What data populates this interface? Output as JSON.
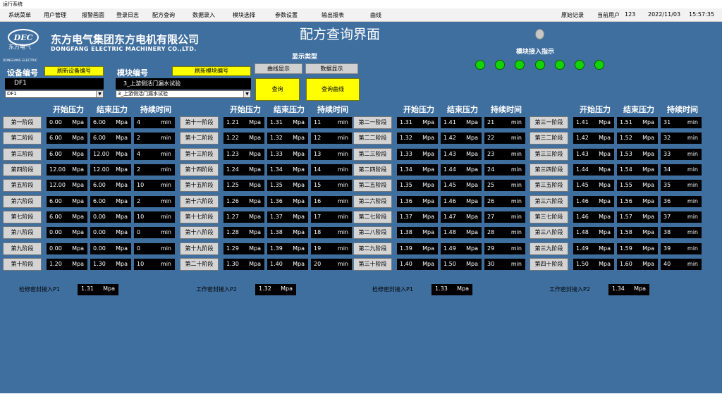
{
  "window_title": "运行系统",
  "menu": [
    "系统菜单",
    "用户管理",
    "报警画面",
    "登录日志",
    "配方查询",
    "数据录入",
    "模块选择",
    "参数设置",
    "输出报表",
    "曲线"
  ],
  "menu_right": {
    "raw_record": "原始记录",
    "current_user_label": "当前用户",
    "user_id": "123",
    "date": "2022/11/03",
    "time": "15:57:35"
  },
  "company": {
    "cn": "东方电气集团东方电机有限公司",
    "en": "DONGFANG ELECTRIC MACHINERY CO.,LTD.",
    "logo_text": "DEC",
    "logo_cn": "东方电气",
    "logo_en": "DONGFANG ELECTRIC"
  },
  "page_title": "配方查询界面",
  "device": {
    "label": "设备编号",
    "refresh_label": "刷新设备编号",
    "value": "DF1",
    "combo": "DF1"
  },
  "module": {
    "label": "模块编号",
    "refresh_label": "刷新模块编号",
    "value": "3_上游侧活门漏水试验",
    "combo": "3_上游侧活门漏水试验"
  },
  "display_type": {
    "label": "显示类型",
    "curve": "曲线显示",
    "data": "数据显示"
  },
  "buttons": {
    "query": "查询",
    "query_curve": "查询曲线"
  },
  "module_indicator_label": "模块接入指示",
  "indicator_colors": {
    "on": "#13d400"
  },
  "headers": {
    "start": "开始压力",
    "end": "结束压力",
    "duration": "持续时间"
  },
  "units": {
    "pressure": "Mpa",
    "time": "min"
  },
  "groups": [
    {
      "stages": [
        {
          "name": "第一阶段",
          "start": "0.00",
          "end": "6.00",
          "dur": "4"
        },
        {
          "name": "第二阶段",
          "start": "6.00",
          "end": "6.00",
          "dur": "2"
        },
        {
          "name": "第三阶段",
          "start": "6.00",
          "end": "12.00",
          "dur": "4"
        },
        {
          "name": "第四阶段",
          "start": "12.00",
          "end": "12.00",
          "dur": "2"
        },
        {
          "name": "第五阶段",
          "start": "12.00",
          "end": "6.00",
          "dur": "10"
        },
        {
          "name": "第六阶段",
          "start": "6.00",
          "end": "6.00",
          "dur": "2"
        },
        {
          "name": "第七阶段",
          "start": "6.00",
          "end": "0.00",
          "dur": "10"
        },
        {
          "name": "第八阶段",
          "start": "0.00",
          "end": "0.00",
          "dur": "0"
        },
        {
          "name": "第九阶段",
          "start": "0.00",
          "end": "0.00",
          "dur": "0"
        },
        {
          "name": "第十阶段",
          "start": "1.20",
          "end": "1.30",
          "dur": "10"
        }
      ]
    },
    {
      "stages": [
        {
          "name": "第十一阶段",
          "start": "1.21",
          "end": "1.31",
          "dur": "11"
        },
        {
          "name": "第十二阶段",
          "start": "1.22",
          "end": "1.32",
          "dur": "12"
        },
        {
          "name": "第十三阶段",
          "start": "1.23",
          "end": "1.33",
          "dur": "13"
        },
        {
          "name": "第十四阶段",
          "start": "1.24",
          "end": "1.34",
          "dur": "14"
        },
        {
          "name": "第十五阶段",
          "start": "1.25",
          "end": "1.35",
          "dur": "15"
        },
        {
          "name": "第十六阶段",
          "start": "1.26",
          "end": "1.36",
          "dur": "16"
        },
        {
          "name": "第十七阶段",
          "start": "1.27",
          "end": "1.37",
          "dur": "17"
        },
        {
          "name": "第十八阶段",
          "start": "1.28",
          "end": "1.38",
          "dur": "18"
        },
        {
          "name": "第十九阶段",
          "start": "1.29",
          "end": "1.39",
          "dur": "19"
        },
        {
          "name": "第二十阶段",
          "start": "1.30",
          "end": "1.40",
          "dur": "20"
        }
      ]
    },
    {
      "stages": [
        {
          "name": "第二一阶段",
          "start": "1.31",
          "end": "1.41",
          "dur": "21"
        },
        {
          "name": "第二二阶段",
          "start": "1.32",
          "end": "1.42",
          "dur": "22"
        },
        {
          "name": "第二三阶段",
          "start": "1.33",
          "end": "1.43",
          "dur": "23"
        },
        {
          "name": "第二四阶段",
          "start": "1.34",
          "end": "1.44",
          "dur": "24"
        },
        {
          "name": "第二五阶段",
          "start": "1.35",
          "end": "1.45",
          "dur": "25"
        },
        {
          "name": "第二六阶段",
          "start": "1.36",
          "end": "1.46",
          "dur": "26"
        },
        {
          "name": "第二七阶段",
          "start": "1.37",
          "end": "1.47",
          "dur": "27"
        },
        {
          "name": "第二八阶段",
          "start": "1.38",
          "end": "1.48",
          "dur": "28"
        },
        {
          "name": "第二九阶段",
          "start": "1.39",
          "end": "1.49",
          "dur": "29"
        },
        {
          "name": "第三十阶段",
          "start": "1.40",
          "end": "1.50",
          "dur": "30"
        }
      ]
    },
    {
      "stages": [
        {
          "name": "第三一阶段",
          "start": "1.41",
          "end": "1.51",
          "dur": "31"
        },
        {
          "name": "第三二阶段",
          "start": "1.42",
          "end": "1.52",
          "dur": "32"
        },
        {
          "name": "第三三阶段",
          "start": "1.43",
          "end": "1.53",
          "dur": "33"
        },
        {
          "name": "第三四阶段",
          "start": "1.44",
          "end": "1.54",
          "dur": "34"
        },
        {
          "name": "第三五阶段",
          "start": "1.45",
          "end": "1.55",
          "dur": "35"
        },
        {
          "name": "第三六阶段",
          "start": "1.46",
          "end": "1.56",
          "dur": "36"
        },
        {
          "name": "第三七阶段",
          "start": "1.46",
          "end": "1.57",
          "dur": "37"
        },
        {
          "name": "第三八阶段",
          "start": "1.48",
          "end": "1.58",
          "dur": "38"
        },
        {
          "name": "第三九阶段",
          "start": "1.49",
          "end": "1.59",
          "dur": "39"
        },
        {
          "name": "第四十阶段",
          "start": "1.50",
          "end": "1.60",
          "dur": "40"
        }
      ]
    }
  ],
  "seals": [
    {
      "label": "检修密封接入P1",
      "value": "1.31"
    },
    {
      "label": "工作密封接入P2",
      "value": "1.32"
    },
    {
      "label": "检修密封接入P1",
      "value": "1.33"
    },
    {
      "label": "工作密封接入P2",
      "value": "1.34"
    }
  ]
}
